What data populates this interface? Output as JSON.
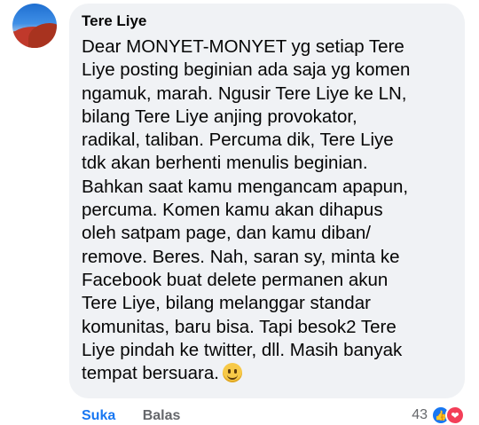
{
  "comment": {
    "author": "Tere Liye",
    "text": "Dear MONYET-MONYET yg setiap Tere\nLiye posting beginian ada saja yg komen\nngamuk, marah. Ngusir Tere Liye ke LN,\nbilang Tere Liye anjing provokator,\nradikal, taliban. Percuma dik, Tere Liye\ntdk akan berhenti menulis beginian.\nBahkan saat kamu mengancam apapun,\npercuma. Komen kamu akan dihapus\noleh satpam page, dan kamu diban/\nremove. Beres. Nah, saran sy, minta ke\nFacebook buat delete permanen akun\nTere Liye, bilang melanggar standar\nkomunitas, baru bisa. Tapi besok2 Tere\nLiye pindah ke twitter, dll. Masih banyak\ntempat bersuara.",
    "emoji": "smile-emoji"
  },
  "actions": {
    "like_label": "Suka",
    "reply_label": "Balas"
  },
  "reactions": {
    "count": "43",
    "icons": [
      "like-icon",
      "love-icon"
    ],
    "colors": {
      "like": "#1877f2",
      "love": "#f33e58"
    }
  }
}
